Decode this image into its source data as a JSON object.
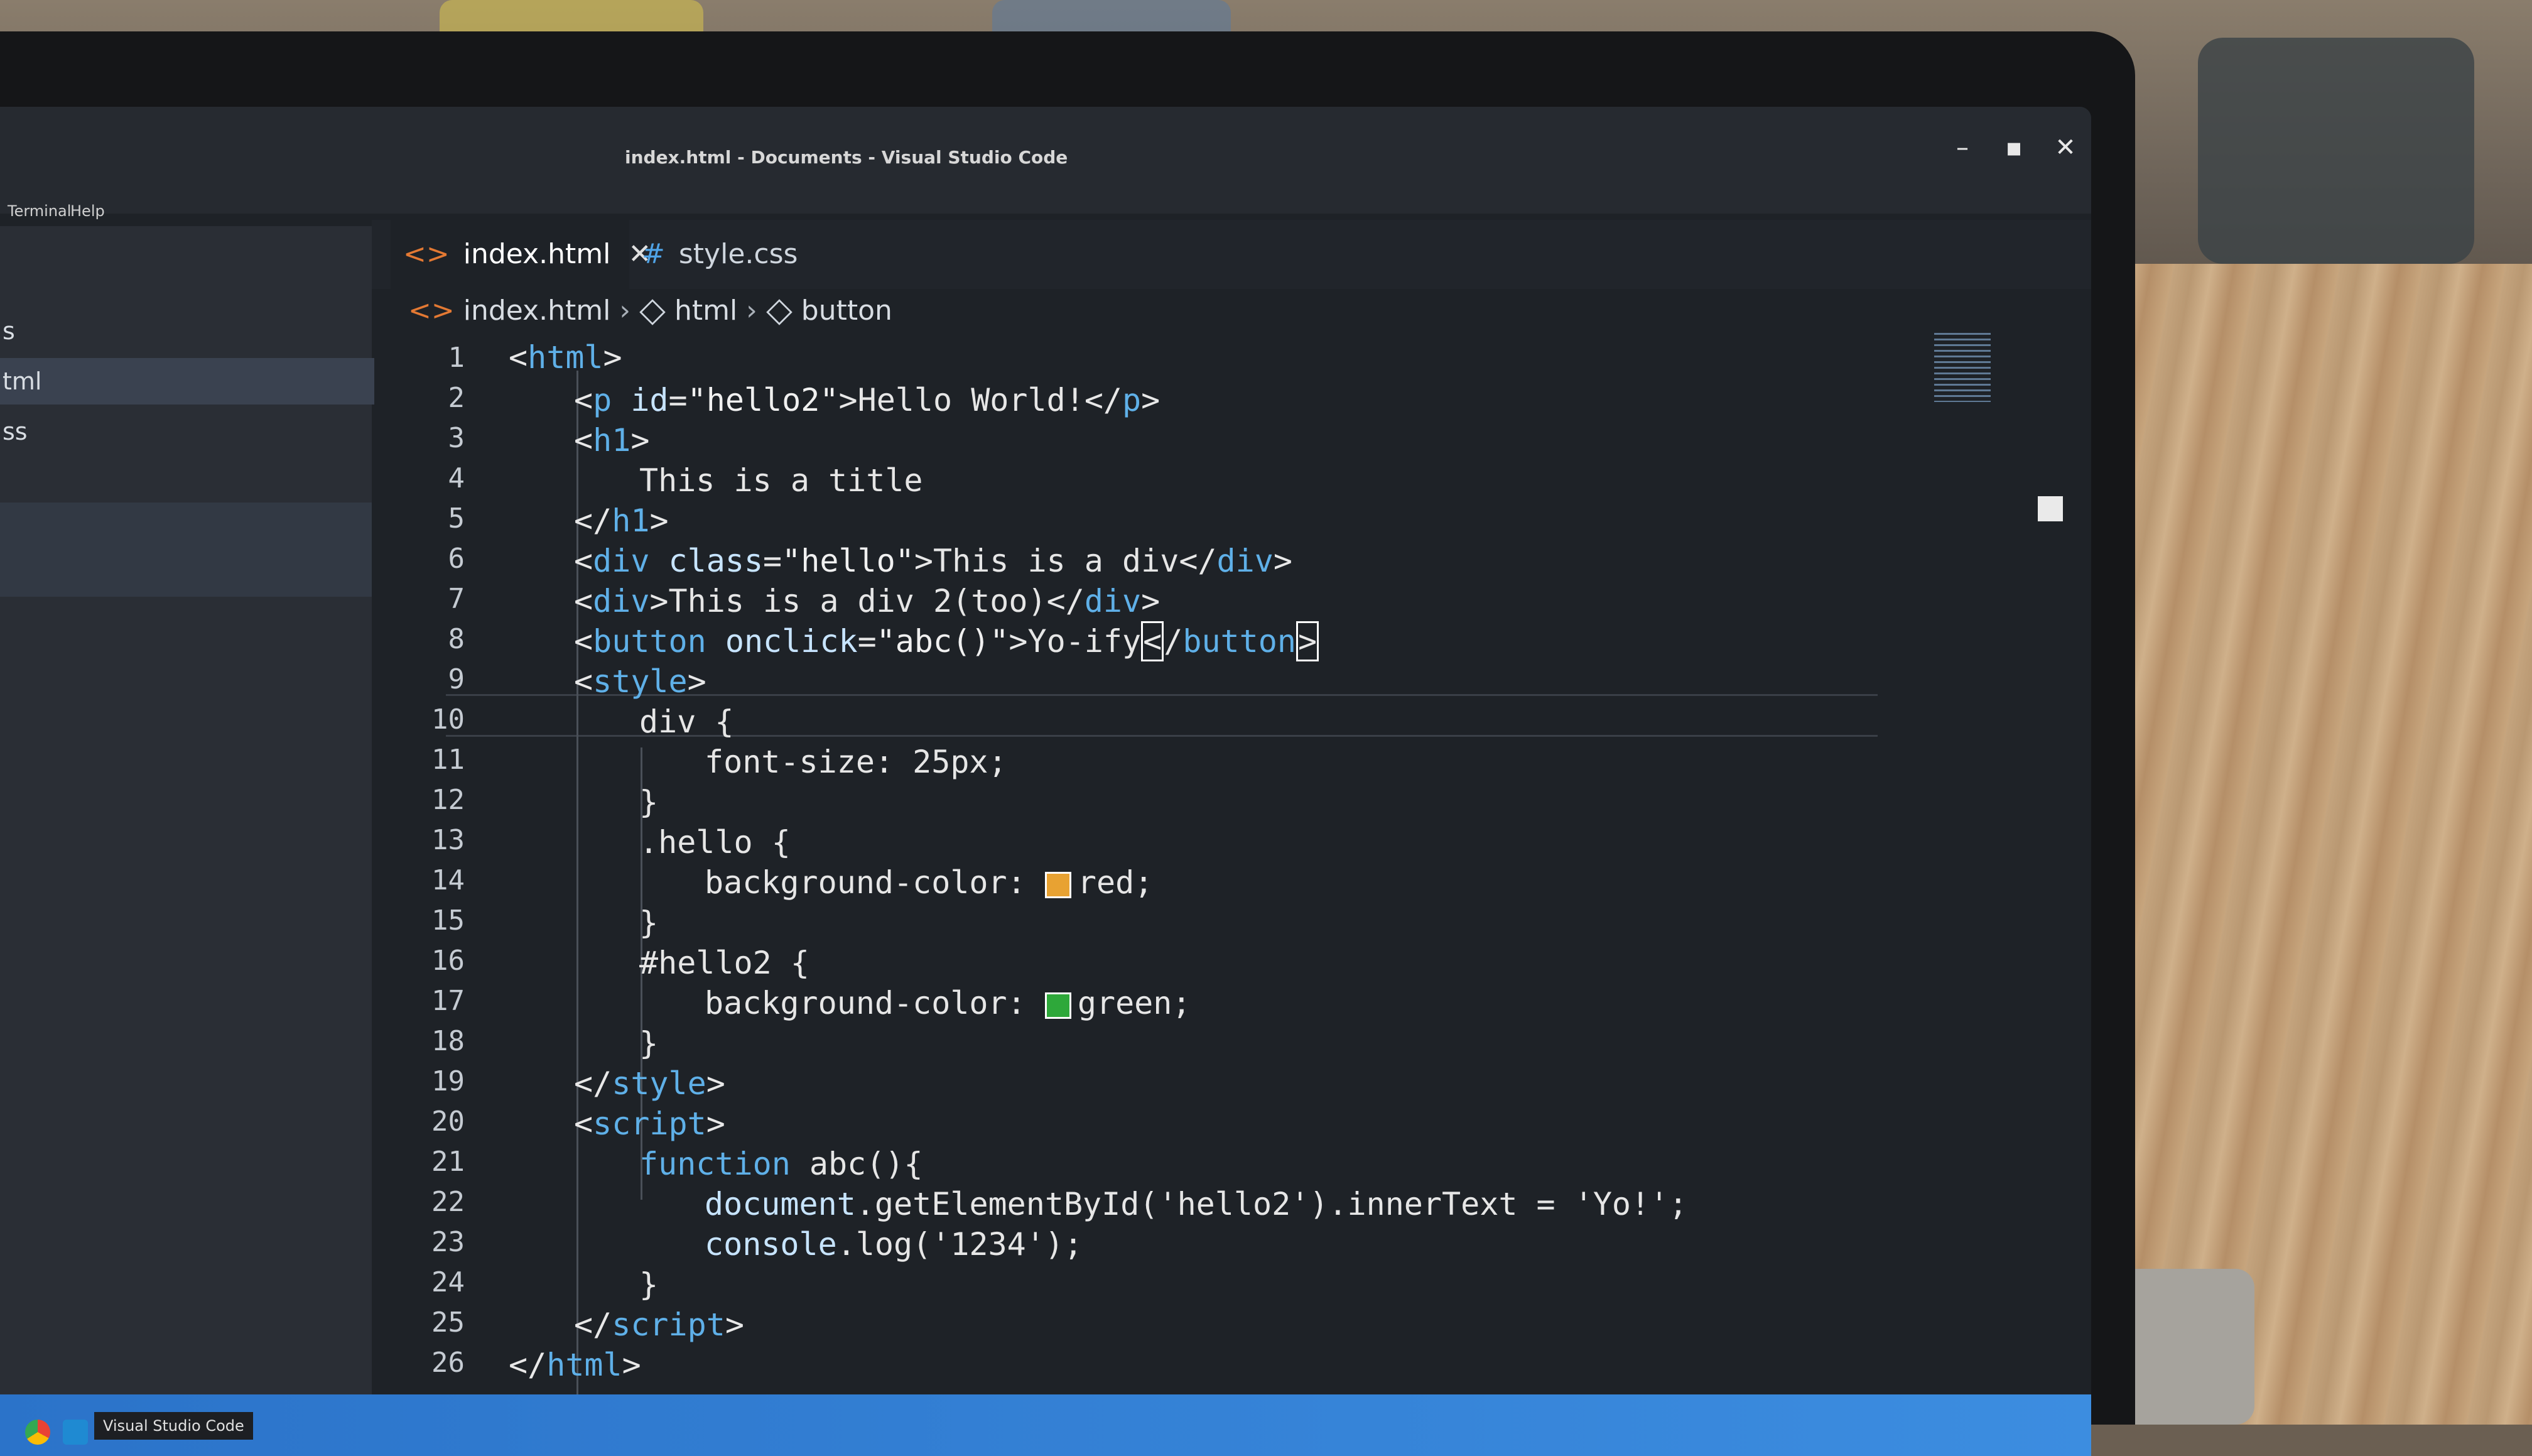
{
  "window": {
    "title": "index.html - Documents - Visual Studio Code"
  },
  "menu": {
    "items": [
      "Terminal",
      "Help"
    ]
  },
  "sidebar": {
    "items": [
      "s",
      "tml",
      "ss"
    ]
  },
  "tabs": [
    {
      "label": "index.html",
      "icon": "html-file-icon",
      "active": true
    },
    {
      "label": "style.css",
      "icon": "css-file-icon",
      "active": false
    }
  ],
  "breadcrumb": {
    "file": "index.html",
    "items": [
      "html",
      "button"
    ]
  },
  "editor": {
    "line_numbers": [
      "1",
      "2",
      "3",
      "4",
      "5",
      "6",
      "7",
      "8",
      "9",
      "10",
      "11",
      "12",
      "13",
      "14",
      "15",
      "16",
      "17",
      "18",
      "19",
      "20",
      "21",
      "22",
      "23",
      "24",
      "25",
      "26"
    ],
    "swatch_colors": {
      "red": "#e8a232",
      "green": "#2ea83a"
    }
  },
  "taskbar": {
    "tooltip": "Visual Studio Code"
  },
  "colors": {
    "accent": "#3c8de0",
    "tag_name": "#5fb0e8",
    "editor_bg": "#1e2227"
  }
}
